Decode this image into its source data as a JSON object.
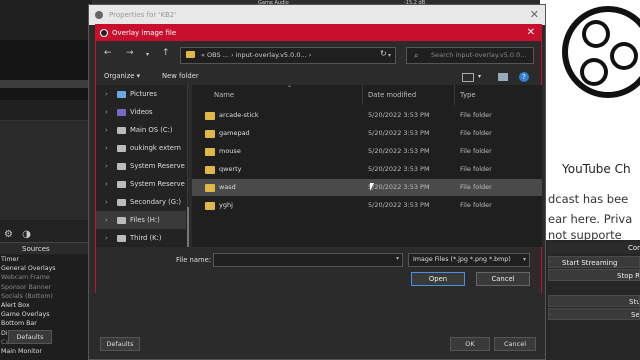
{
  "background": {
    "top_bar": {
      "game_audio": "Game Audio",
      "db": "-15.2 dB"
    },
    "mini_list": [
      "",
      "",
      "",
      "",
      "",
      "",
      ""
    ],
    "sources_header": "Sources",
    "sources": [
      {
        "label": "Timer",
        "dim": false
      },
      {
        "label": "General Overlays",
        "dim": false
      },
      {
        "label": "Webcam Frame",
        "dim": true
      },
      {
        "label": "Sponsor Banner",
        "dim": true
      },
      {
        "label": "Socials (Bottom)",
        "dim": true
      },
      {
        "label": "Alert Box",
        "dim": false
      },
      {
        "label": "Game Overlays",
        "dim": false
      },
      {
        "label": "Bottom Bar",
        "dim": false
      },
      {
        "label": "Display",
        "dim": false
      },
      {
        "label": "Camera",
        "dim": true
      },
      {
        "label": "Main Monitor",
        "dim": false
      }
    ],
    "youtube_title": "YouTube Ch",
    "youtube_lines": [
      "dcast has bee",
      "ear here. Priva",
      "not supporte"
    ],
    "controls": [
      "Con",
      "Start Streaming",
      "Stop Re",
      "Stu",
      "Se"
    ]
  },
  "properties_dialog": {
    "title": "Properties for 'KB2'",
    "defaults_label": "Defaults",
    "ok_label": "OK",
    "cancel_label": "Cancel"
  },
  "file_dialog": {
    "title": "Overlay image file",
    "address": "« OBS ... › input-overlay.v5.0.0... ›",
    "search_placeholder": "Search input-overlay.v5.0.0...",
    "organize_label": "Organize ▾",
    "new_folder_label": "New folder",
    "nav_items": [
      {
        "label": "Pictures",
        "selected": false
      },
      {
        "label": "Videos",
        "selected": false
      },
      {
        "label": "Main OS (C:)",
        "selected": false
      },
      {
        "label": "oukingk extern",
        "selected": false
      },
      {
        "label": "System Reserve",
        "selected": false
      },
      {
        "label": "System Reserve",
        "selected": false
      },
      {
        "label": "Secondary (G:)",
        "selected": false
      },
      {
        "label": "Files (H:)",
        "selected": true
      },
      {
        "label": "Third (K:)",
        "selected": false
      }
    ],
    "columns": {
      "name": "Name",
      "date": "Date modified",
      "type": "Type"
    },
    "files": [
      {
        "name": "arcade-stick",
        "date": "5/20/2022 3:53 PM",
        "type": "File folder",
        "hover": false
      },
      {
        "name": "gamepad",
        "date": "5/20/2022 3:53 PM",
        "type": "File folder",
        "hover": false
      },
      {
        "name": "mouse",
        "date": "5/20/2022 3:53 PM",
        "type": "File folder",
        "hover": false
      },
      {
        "name": "qwerty",
        "date": "5/20/2022 3:53 PM",
        "type": "File folder",
        "hover": false
      },
      {
        "name": "wasd",
        "date": "5/20/2022 3:53 PM",
        "type": "File folder",
        "hover": true
      },
      {
        "name": "yghj",
        "date": "5/20/2022 3:53 PM",
        "type": "File folder",
        "hover": false
      }
    ],
    "file_name_label": "File name:",
    "file_name_value": "",
    "filter_value": "Image Files (*.jpg *.png *.bmp)",
    "open_label": "Open",
    "cancel_label": "Cancel"
  }
}
